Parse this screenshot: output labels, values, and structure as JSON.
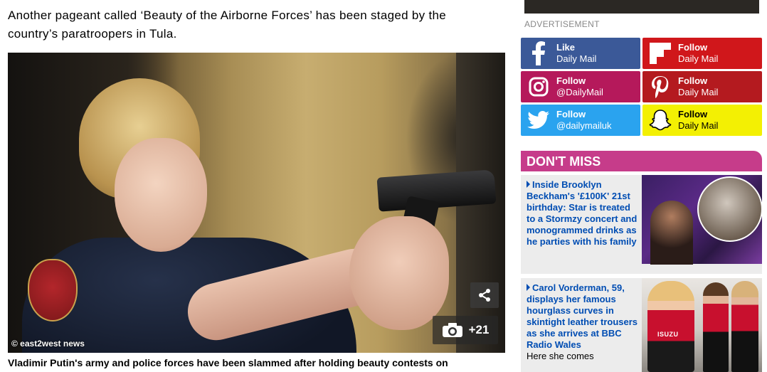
{
  "article": {
    "paragraph": "Another pageant called ‘Beauty of the Airborne Forces’ has been staged by the country’s paratroopers in Tula.",
    "photo": {
      "credit": "© east2west news",
      "gallery_count": "+21",
      "share_icon": "share-icon",
      "camera_icon": "camera-icon"
    },
    "caption": "Vladimir Putin's army and police forces have been slammed after holding beauty contests on"
  },
  "sidebar": {
    "ad_label": "ADVERTISEMENT",
    "social": [
      {
        "network": "facebook",
        "line1": "Like",
        "line2": "Daily Mail",
        "color": "#3b5998"
      },
      {
        "network": "flipboard",
        "line1": "Follow",
        "line2": "Daily Mail",
        "color": "#d0171b"
      },
      {
        "network": "instagram",
        "line1": "Follow",
        "line2": "@DailyMail",
        "color": "#b5195b"
      },
      {
        "network": "pinterest",
        "line1": "Follow",
        "line2": "Daily Mail",
        "color": "#b41a1f"
      },
      {
        "network": "twitter",
        "line1": "Follow",
        "line2": "@dailymailuk",
        "color": "#2aa3ef"
      },
      {
        "network": "snapchat",
        "line1": "Follow",
        "line2": "Daily Mail",
        "color": "#f3f003"
      }
    ],
    "dont_miss": {
      "title": "DON'T MISS",
      "color": "#c63c8a",
      "items": [
        {
          "headline": "Inside Brooklyn Beckham's '£100K' 21st birthday: Star is treated to a Stormzy concert and monogrammed drinks as he parties with his family",
          "subline": ""
        },
        {
          "headline": "Carol Vorderman, 59, displays her famous hourglass curves in skintight leather trousers as she arrives at BBC Radio Wales",
          "subline": "Here she comes",
          "image_brand": "ISUZU"
        }
      ]
    }
  }
}
